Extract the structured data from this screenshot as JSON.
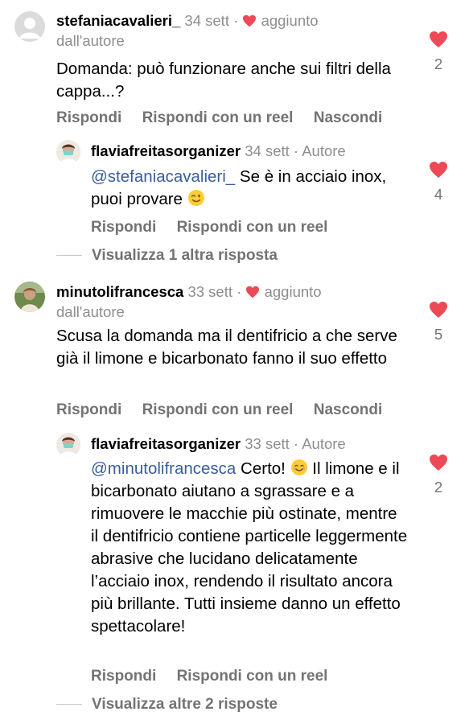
{
  "colors": {
    "heart": "#ed4956",
    "muted": "#737373",
    "mention": "#3a5d9c"
  },
  "comments": [
    {
      "username": "stefaniacavalieri_",
      "time": "34 sett",
      "liked_by_author": "aggiunto dall'autore",
      "text": "Domanda: può funzionare anche sui filtri della cappa...?",
      "likes": "2",
      "actions": [
        "Rispondi",
        "Rispondi con un reel",
        "Nascondi"
      ],
      "reply": {
        "username": "flaviafreitasorganizer",
        "time": "34 sett",
        "badge": "Autore",
        "mention": "@stefaniacavalieri_",
        "text": "Se è in acciaio inox, puoi provare",
        "emoji": "wink-emoji",
        "likes": "4",
        "actions": [
          "Rispondi",
          "Rispondi con un reel"
        ]
      },
      "view_more": "Visualizza 1 altra risposta"
    },
    {
      "username": "minutolifrancesca",
      "time": "33 sett",
      "liked_by_author": "aggiunto dall'autore",
      "text": "Scusa la domanda ma il dentifricio a che serve già il limone e bicarbonato fanno il suo effetto",
      "likes": "5",
      "actions": [
        "Rispondi",
        "Rispondi con un reel",
        "Nascondi"
      ],
      "reply": {
        "username": "flaviafreitasorganizer",
        "time": "33 sett",
        "badge": "Autore",
        "mention": "@minutolifrancesca",
        "text_a": "Certo!",
        "emoji": "smile-emoji",
        "text_b": "Il limone e il bicarbonato aiutano a sgrassare e a rimuovere le macchie più ostinate, mentre il dentifricio contiene particelle leggermente abrasive che lucidano delicatamente l’acciaio inox, rendendo il risultato ancora più brillante. Tutti insieme danno un effetto spettacolare!",
        "likes": "2",
        "actions": [
          "Rispondi",
          "Rispondi con un reel"
        ]
      },
      "view_more": "Visualizza altre 2 risposte"
    }
  ]
}
